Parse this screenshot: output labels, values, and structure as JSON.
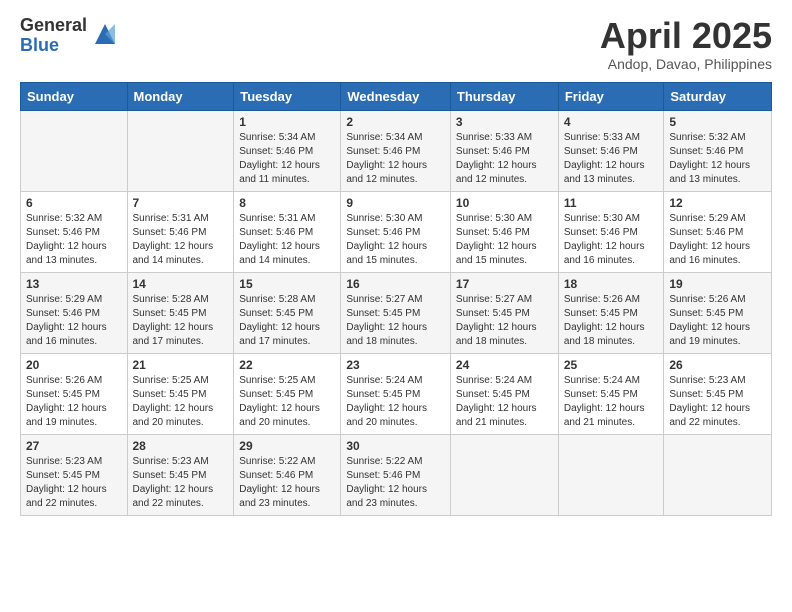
{
  "logo": {
    "general": "General",
    "blue": "Blue"
  },
  "title": "April 2025",
  "subtitle": "Andop, Davao, Philippines",
  "days_of_week": [
    "Sunday",
    "Monday",
    "Tuesday",
    "Wednesday",
    "Thursday",
    "Friday",
    "Saturday"
  ],
  "weeks": [
    [
      {
        "day": "",
        "info": ""
      },
      {
        "day": "",
        "info": ""
      },
      {
        "day": "1",
        "sunrise": "5:34 AM",
        "sunset": "5:46 PM",
        "daylight": "12 hours and 11 minutes."
      },
      {
        "day": "2",
        "sunrise": "5:34 AM",
        "sunset": "5:46 PM",
        "daylight": "12 hours and 12 minutes."
      },
      {
        "day": "3",
        "sunrise": "5:33 AM",
        "sunset": "5:46 PM",
        "daylight": "12 hours and 12 minutes."
      },
      {
        "day": "4",
        "sunrise": "5:33 AM",
        "sunset": "5:46 PM",
        "daylight": "12 hours and 13 minutes."
      },
      {
        "day": "5",
        "sunrise": "5:32 AM",
        "sunset": "5:46 PM",
        "daylight": "12 hours and 13 minutes."
      }
    ],
    [
      {
        "day": "6",
        "sunrise": "5:32 AM",
        "sunset": "5:46 PM",
        "daylight": "12 hours and 13 minutes."
      },
      {
        "day": "7",
        "sunrise": "5:31 AM",
        "sunset": "5:46 PM",
        "daylight": "12 hours and 14 minutes."
      },
      {
        "day": "8",
        "sunrise": "5:31 AM",
        "sunset": "5:46 PM",
        "daylight": "12 hours and 14 minutes."
      },
      {
        "day": "9",
        "sunrise": "5:30 AM",
        "sunset": "5:46 PM",
        "daylight": "12 hours and 15 minutes."
      },
      {
        "day": "10",
        "sunrise": "5:30 AM",
        "sunset": "5:46 PM",
        "daylight": "12 hours and 15 minutes."
      },
      {
        "day": "11",
        "sunrise": "5:30 AM",
        "sunset": "5:46 PM",
        "daylight": "12 hours and 16 minutes."
      },
      {
        "day": "12",
        "sunrise": "5:29 AM",
        "sunset": "5:46 PM",
        "daylight": "12 hours and 16 minutes."
      }
    ],
    [
      {
        "day": "13",
        "sunrise": "5:29 AM",
        "sunset": "5:46 PM",
        "daylight": "12 hours and 16 minutes."
      },
      {
        "day": "14",
        "sunrise": "5:28 AM",
        "sunset": "5:45 PM",
        "daylight": "12 hours and 17 minutes."
      },
      {
        "day": "15",
        "sunrise": "5:28 AM",
        "sunset": "5:45 PM",
        "daylight": "12 hours and 17 minutes."
      },
      {
        "day": "16",
        "sunrise": "5:27 AM",
        "sunset": "5:45 PM",
        "daylight": "12 hours and 18 minutes."
      },
      {
        "day": "17",
        "sunrise": "5:27 AM",
        "sunset": "5:45 PM",
        "daylight": "12 hours and 18 minutes."
      },
      {
        "day": "18",
        "sunrise": "5:26 AM",
        "sunset": "5:45 PM",
        "daylight": "12 hours and 18 minutes."
      },
      {
        "day": "19",
        "sunrise": "5:26 AM",
        "sunset": "5:45 PM",
        "daylight": "12 hours and 19 minutes."
      }
    ],
    [
      {
        "day": "20",
        "sunrise": "5:26 AM",
        "sunset": "5:45 PM",
        "daylight": "12 hours and 19 minutes."
      },
      {
        "day": "21",
        "sunrise": "5:25 AM",
        "sunset": "5:45 PM",
        "daylight": "12 hours and 20 minutes."
      },
      {
        "day": "22",
        "sunrise": "5:25 AM",
        "sunset": "5:45 PM",
        "daylight": "12 hours and 20 minutes."
      },
      {
        "day": "23",
        "sunrise": "5:24 AM",
        "sunset": "5:45 PM",
        "daylight": "12 hours and 20 minutes."
      },
      {
        "day": "24",
        "sunrise": "5:24 AM",
        "sunset": "5:45 PM",
        "daylight": "12 hours and 21 minutes."
      },
      {
        "day": "25",
        "sunrise": "5:24 AM",
        "sunset": "5:45 PM",
        "daylight": "12 hours and 21 minutes."
      },
      {
        "day": "26",
        "sunrise": "5:23 AM",
        "sunset": "5:45 PM",
        "daylight": "12 hours and 22 minutes."
      }
    ],
    [
      {
        "day": "27",
        "sunrise": "5:23 AM",
        "sunset": "5:45 PM",
        "daylight": "12 hours and 22 minutes."
      },
      {
        "day": "28",
        "sunrise": "5:23 AM",
        "sunset": "5:45 PM",
        "daylight": "12 hours and 22 minutes."
      },
      {
        "day": "29",
        "sunrise": "5:22 AM",
        "sunset": "5:46 PM",
        "daylight": "12 hours and 23 minutes."
      },
      {
        "day": "30",
        "sunrise": "5:22 AM",
        "sunset": "5:46 PM",
        "daylight": "12 hours and 23 minutes."
      },
      {
        "day": "",
        "info": ""
      },
      {
        "day": "",
        "info": ""
      },
      {
        "day": "",
        "info": ""
      }
    ]
  ],
  "labels": {
    "sunrise": "Sunrise:",
    "sunset": "Sunset:",
    "daylight": "Daylight:"
  }
}
